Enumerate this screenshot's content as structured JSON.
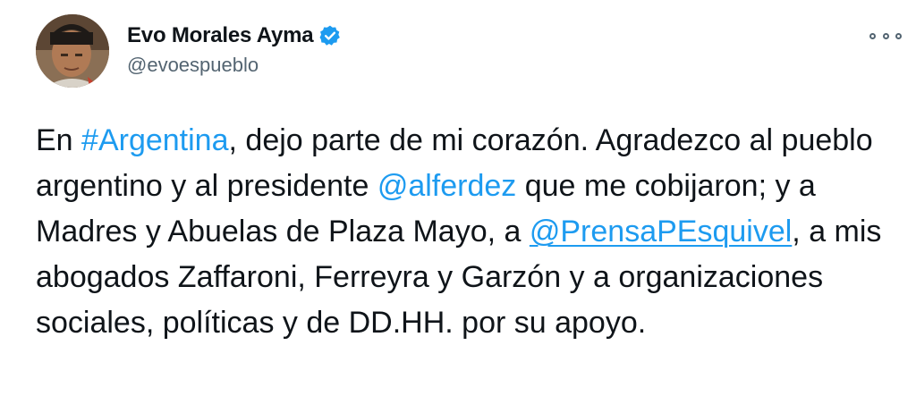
{
  "author": {
    "display_name": "Evo Morales Ayma",
    "handle": "@evoespueblo",
    "verified": true
  },
  "menu": {
    "icon": "more-options-icon"
  },
  "tweet": {
    "seg1": "En ",
    "hashtag": "#Argentina",
    "seg2": ", dejo parte de mi corazón. Agradezco al pueblo argentino y al presidente ",
    "mention1": "@alferdez",
    "seg3": " que me cobijaron; y a Madres y Abuelas de Plaza Mayo, a ",
    "mention2": "@PrensaPEsquivel",
    "seg4": ", a mis abogados Zaffaroni, Ferreyra y Garzón y a organizaciones sociales, políticas y de DD.HH. por su apoyo."
  },
  "colors": {
    "link": "#1d9bf0",
    "verified": "#1d9bf0",
    "handle": "#536471",
    "text": "#0f1419"
  }
}
